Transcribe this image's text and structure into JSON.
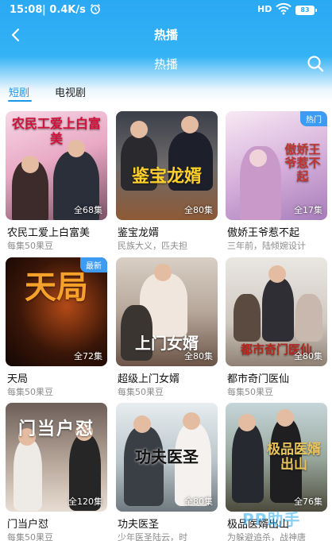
{
  "statusbar": {
    "time": "15:08",
    "speed": "| 0.4K/s",
    "alarm_icon": "alarm-clock-icon",
    "signal": "HD",
    "wifi_icon": "wifi-icon",
    "battery": "83"
  },
  "appbar": {
    "title": "热播",
    "back_icon": "chevron-left-icon"
  },
  "subbar": {
    "title": "热播",
    "search_icon": "search-icon"
  },
  "tabs": [
    {
      "label": "短剧",
      "active": true
    },
    {
      "label": "电视剧",
      "active": false
    }
  ],
  "colors": {
    "accent": "#1896e8",
    "header": "#2aa9f3",
    "badge": "#3d9cf2"
  },
  "cards": [
    {
      "title": "农民工爱上白富美",
      "subtitle": "每集50果豆",
      "count": "全68集",
      "badge": "",
      "poster_text": "农民工爱上白富美"
    },
    {
      "title": "鉴宝龙婿",
      "subtitle": "民族大义，匹夫担",
      "count": "全80集",
      "badge": "",
      "poster_text": "鉴宝龙婿"
    },
    {
      "title": "傲娇王爷惹不起",
      "subtitle": "三年前，陆倾婉设计",
      "count": "全17集",
      "badge": "热门",
      "poster_text": "傲娇王爷惹不起"
    },
    {
      "title": "天局",
      "subtitle": "每集50果豆",
      "count": "全72集",
      "badge": "最新",
      "poster_text": "天局"
    },
    {
      "title": "超级上门女婿",
      "subtitle": "每集50果豆",
      "count": "全80集",
      "badge": "",
      "poster_text": "上门女婿"
    },
    {
      "title": "都市奇门医仙",
      "subtitle": "每集50果豆",
      "count": "全80集",
      "badge": "",
      "poster_text": "都市奇门医仙"
    },
    {
      "title": "门当户怼",
      "subtitle": "每集50果豆",
      "count": "全120集",
      "badge": "",
      "poster_text": "门当户怼"
    },
    {
      "title": "功夫医圣",
      "subtitle": "少年医圣陆云，时",
      "count": "全80集",
      "badge": "",
      "poster_text": "功夫医圣"
    },
    {
      "title": "极品医婿出山",
      "subtitle": "为躲避追杀，战神唐",
      "count": "全76集",
      "badge": "",
      "poster_text": "极品医婿出山"
    }
  ],
  "watermark": "PP助手"
}
